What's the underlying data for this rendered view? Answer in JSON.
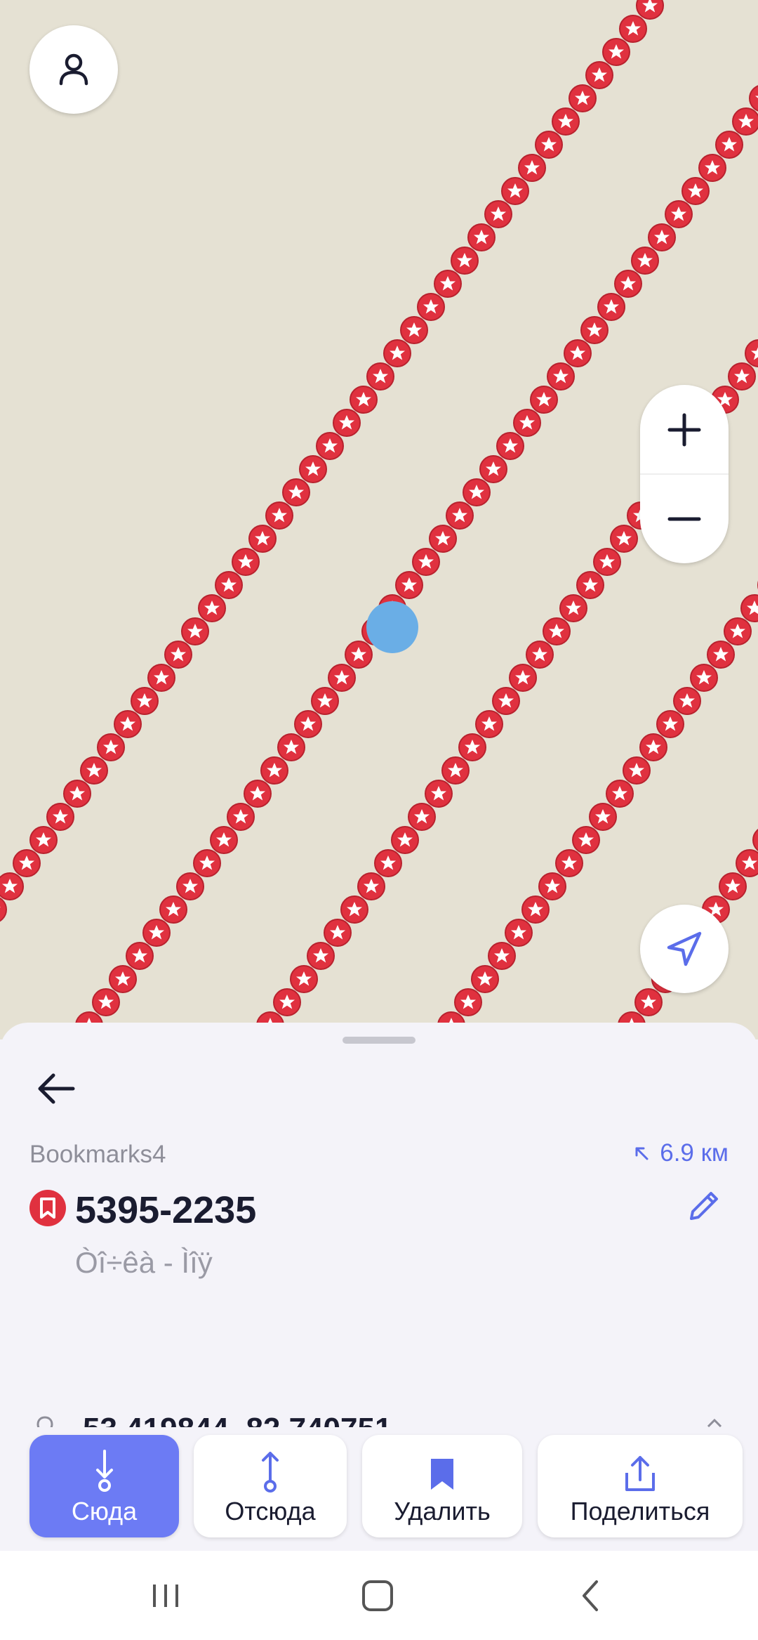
{
  "map": {
    "background": "#e5e1d3",
    "pin_color": "#e0313f",
    "location_dot_color": "#6aaee6"
  },
  "controls": {
    "profile_icon": "person-icon",
    "zoom_in_icon": "plus-icon",
    "zoom_out_icon": "minus-icon",
    "locate_icon": "navigation-arrow-icon"
  },
  "place": {
    "collection": "Bookmarks4",
    "distance": "6.9 км",
    "title": "5395-2235",
    "subtitle": "Òî÷êà - Ìîÿ",
    "coordinates": "53.419844, 82.740751"
  },
  "actions": [
    {
      "label": "Сюда",
      "icon": "route-to-icon"
    },
    {
      "label": "Отсюда",
      "icon": "route-from-icon"
    },
    {
      "label": "Удалить",
      "icon": "bookmark-icon"
    },
    {
      "label": "Поделиться",
      "icon": "share-icon"
    }
  ],
  "accent": "#6c7bf4"
}
